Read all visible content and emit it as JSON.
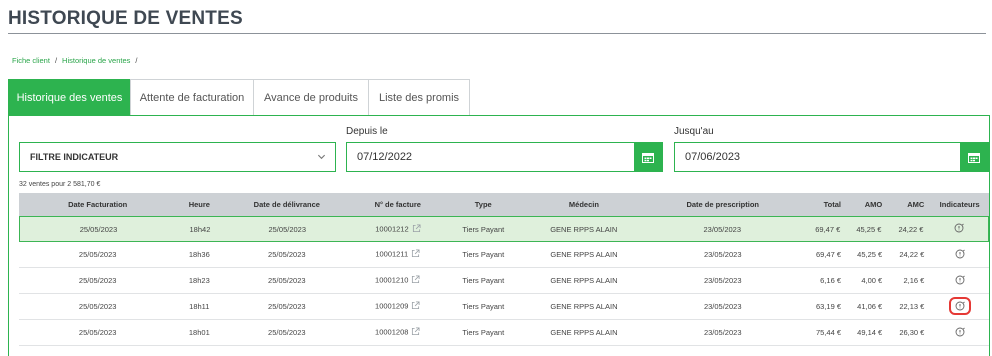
{
  "page": {
    "title": "HISTORIQUE DE VENTES"
  },
  "breadcrumb": [
    {
      "label": "Fiche client"
    },
    {
      "label": "Historique de ventes"
    }
  ],
  "breadcrumb_sep": "/",
  "tabs": [
    {
      "label": "Historique des ventes",
      "active": true
    },
    {
      "label": "Attente de facturation",
      "active": false
    },
    {
      "label": "Avance de produits",
      "active": false
    },
    {
      "label": "Liste des promis",
      "active": false
    }
  ],
  "filter": {
    "label": "FILTRE INDICATEUR"
  },
  "dates": {
    "from_label": "Depuis le",
    "from_value": "07/12/2022",
    "to_label": "Jusqu'au",
    "to_value": "07/06/2023"
  },
  "summary": "32 ventes pour 2 581,70 €",
  "table": {
    "columns": [
      "Date Facturation",
      "Heure",
      "Date de délivrance",
      "N° de facture",
      "Type",
      "Médecin",
      "Date de prescription",
      "Total",
      "AMO",
      "AMC",
      "Indicateurs"
    ],
    "rows": [
      {
        "date": "25/05/2023",
        "heure": "18h42",
        "delivrance": "25/05/2023",
        "facture": "10001212",
        "type": "Tiers Payant",
        "medecin": "GENE RPPS ALAIN",
        "prescription": "23/05/2023",
        "total": "69,47 €",
        "amo": "45,25 €",
        "amc": "24,22 €",
        "selected": true,
        "highlighted": false
      },
      {
        "date": "25/05/2023",
        "heure": "18h36",
        "delivrance": "25/05/2023",
        "facture": "10001211",
        "type": "Tiers Payant",
        "medecin": "GENE RPPS ALAIN",
        "prescription": "23/05/2023",
        "total": "69,47 €",
        "amo": "45,25 €",
        "amc": "24,22 €",
        "selected": false,
        "highlighted": false
      },
      {
        "date": "25/05/2023",
        "heure": "18h23",
        "delivrance": "25/05/2023",
        "facture": "10001210",
        "type": "Tiers Payant",
        "medecin": "GENE RPPS ALAIN",
        "prescription": "23/05/2023",
        "total": "6,16 €",
        "amo": "4,00 €",
        "amc": "2,16 €",
        "selected": false,
        "highlighted": false
      },
      {
        "date": "25/05/2023",
        "heure": "18h11",
        "delivrance": "25/05/2023",
        "facture": "10001209",
        "type": "Tiers Payant",
        "medecin": "GENE RPPS ALAIN",
        "prescription": "23/05/2023",
        "total": "63,19 €",
        "amo": "41,06 €",
        "amc": "22,13 €",
        "selected": false,
        "highlighted": true
      },
      {
        "date": "25/05/2023",
        "heure": "18h01",
        "delivrance": "25/05/2023",
        "facture": "10001208",
        "type": "Tiers Payant",
        "medecin": "GENE RPPS ALAIN",
        "prescription": "23/05/2023",
        "total": "75,44 €",
        "amo": "49,14 €",
        "amc": "26,30 €",
        "selected": false,
        "highlighted": false
      }
    ]
  },
  "icons": {
    "calendar": "calendar-icon",
    "chevron": "chevron-down-icon",
    "external": "open-invoice-icon",
    "indicator": "indicator-info-icon"
  },
  "colors": {
    "accent": "#2db34f",
    "selected_row": "#dff0dc",
    "header": "#cdd1d5",
    "highlight": "#e53935"
  }
}
